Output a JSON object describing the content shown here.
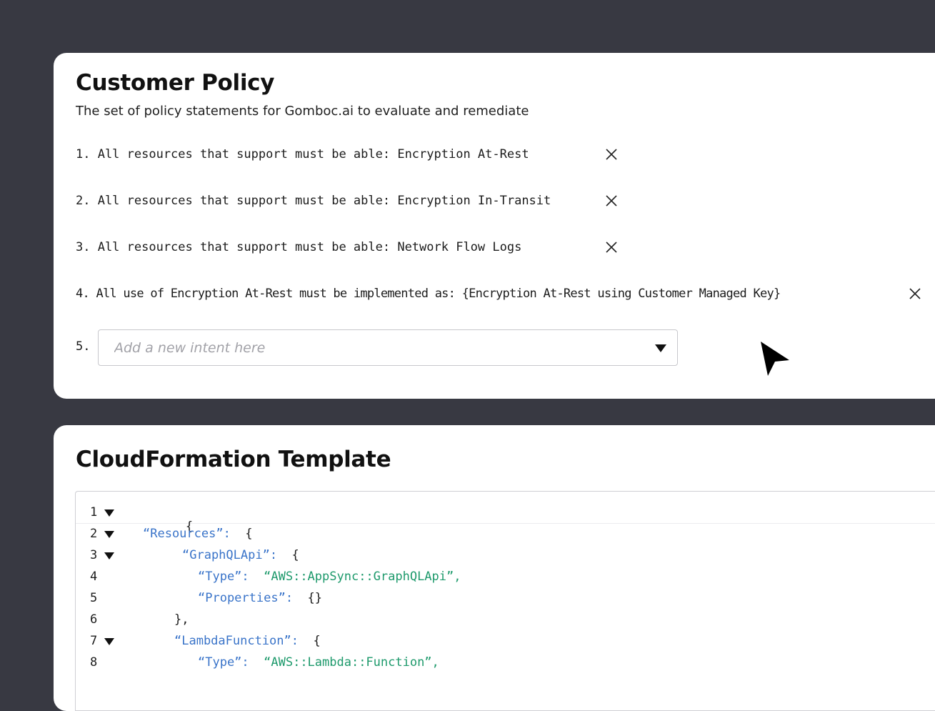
{
  "policy": {
    "title": "Customer Policy",
    "subtitle": "The set of policy statements for Gomboc.ai to evaluate and remediate",
    "items": [
      {
        "text": "1. All resources that support must be able: Encryption At-Rest"
      },
      {
        "text": "2. All resources that support must be able: Encryption In-Transit"
      },
      {
        "text": "3. All resources that support must be able: Network Flow Logs"
      },
      {
        "text": "4. All use of Encryption At-Rest must be implemented as: {Encryption At-Rest using Customer Managed Key}"
      }
    ],
    "new_intent": {
      "number": "5.",
      "placeholder": "Add a new intent here",
      "value": ""
    },
    "icons": {
      "remove": "close-icon",
      "dropdown": "caret-down-icon",
      "cursor": "mouse-pointer-icon"
    }
  },
  "template": {
    "title": "CloudFormation Template",
    "lines": [
      {
        "num": "1",
        "fold": true,
        "parts": [
          {
            "t": "{",
            "c": "p"
          }
        ]
      },
      {
        "num": "2",
        "fold": true,
        "parts": [
          {
            "t": "“Resources”:",
            "c": "k"
          },
          {
            "t": "  {",
            "c": "p"
          }
        ]
      },
      {
        "num": "3",
        "fold": true,
        "parts": [
          {
            "t": "“GraphQLApi”:",
            "c": "k"
          },
          {
            "t": "  {",
            "c": "p"
          }
        ]
      },
      {
        "num": "4",
        "fold": false,
        "parts": [
          {
            "t": "“Type”:",
            "c": "k"
          },
          {
            "t": "  ",
            "c": "p"
          },
          {
            "t": "“AWS::AppSync::GraphQLApi”,",
            "c": "s"
          }
        ]
      },
      {
        "num": "5",
        "fold": false,
        "parts": [
          {
            "t": "“Properties”:",
            "c": "k"
          },
          {
            "t": "  {}",
            "c": "p"
          }
        ]
      },
      {
        "num": "6",
        "fold": false,
        "parts": [
          {
            "t": "},",
            "c": "p"
          }
        ]
      },
      {
        "num": "7",
        "fold": true,
        "parts": [
          {
            "t": "“LambdaFunction”:",
            "c": "k"
          },
          {
            "t": "  {",
            "c": "p"
          }
        ]
      },
      {
        "num": "8",
        "fold": false,
        "parts": [
          {
            "t": "“Type”:",
            "c": "k"
          },
          {
            "t": "  ",
            "c": "p"
          },
          {
            "t": "“AWS::Lambda::Function”,",
            "c": "s"
          }
        ]
      }
    ],
    "icons": {
      "fold": "caret-down-icon"
    }
  },
  "colors": {
    "background": "#383942",
    "card": "#ffffff",
    "json_key": "#3a74c9",
    "json_string": "#1e9a6c"
  }
}
